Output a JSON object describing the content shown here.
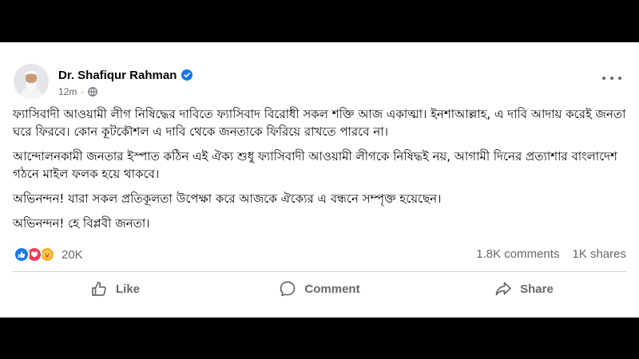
{
  "post": {
    "author": "Dr. Shafiqur Rahman",
    "time": "12m",
    "paragraphs": [
      "ফ্যাসিবাদী আওয়ামী লীগ নিষিদ্ধের দাবিতে ফ্যাসিবাদ বিরোধী সকল শক্তি আজ একাত্মা। ইনশাআল্লাহ, এ দাবি আদায় করেই জনতা ঘরে ফিরবে। কোন কূটকৌশল এ দাবি থেকে জনতাকে ফিরিয়ে রাখতে পারবে না।",
      "আন্দোলনকামী জনতার ইস্পাত কঠিন এই ঐক্য শুধু ফ্যাসিবাদী আওয়ামী লীগকে নিষিদ্ধই নয়, আগামী দিনের প্রত্যাশার বাংলাদেশ গঠনে মাইল ফলক হয়ে থাকবে।",
      "অভিনন্দন! যারা সকল প্রতিকূলতা উপেক্ষা করে আজকে ঐক্যের এ বন্ধনে সম্পৃক্ত হয়েছেন।",
      "অভিনন্দন! হে বিপ্লবী জনতা।"
    ]
  },
  "stats": {
    "reaction_count": "20K",
    "comments": "1.8K comments",
    "shares": "1K shares"
  },
  "actions": {
    "like": "Like",
    "comment": "Comment",
    "share": "Share"
  },
  "icons": {
    "verified": "verified-badge-icon",
    "audience": "globe-icon",
    "more": "more-options-icon",
    "reactions": [
      "like-reaction-icon",
      "love-reaction-icon",
      "care-reaction-icon"
    ]
  },
  "colors": {
    "accent": "#1877f2",
    "text": "#050505",
    "secondary_text": "#65676b",
    "love": "#f33e58",
    "care": "#f7b125"
  }
}
